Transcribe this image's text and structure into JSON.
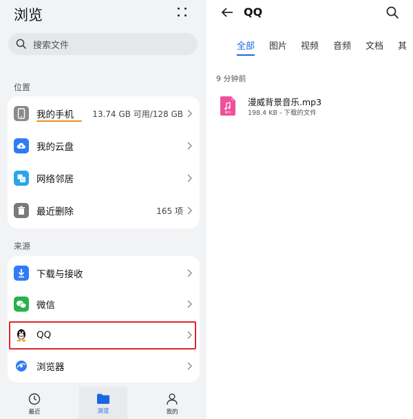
{
  "left": {
    "title": "浏览",
    "search_placeholder": "搜索文件",
    "section_location": "位置",
    "section_source": "来源",
    "location_items": [
      {
        "label": "我的手机",
        "value": "13.74 GB 可用/128 GB",
        "icon": "phone-icon",
        "color": "#8a8a8a",
        "storage_used_fraction": 0.89
      },
      {
        "label": "我的云盘",
        "value": "",
        "icon": "cloud-icon",
        "color": "#2f7cf6"
      },
      {
        "label": "网络邻居",
        "value": "",
        "icon": "network-icon",
        "color": "#2aa6e8"
      },
      {
        "label": "最近删除",
        "value": "165 项",
        "icon": "trash-icon",
        "color": "#7a7a7a"
      }
    ],
    "source_items": [
      {
        "label": "下载与接收",
        "icon": "download-icon",
        "color": "#2f7cf6"
      },
      {
        "label": "微信",
        "icon": "wechat-icon",
        "color": "#2bb14c"
      },
      {
        "label": "QQ",
        "icon": "qq-icon",
        "color": "#111111"
      },
      {
        "label": "浏览器",
        "icon": "browser-icon",
        "color": "#2f7cf6"
      }
    ],
    "nav": [
      {
        "label": "最近",
        "icon": "clock-icon"
      },
      {
        "label": "浏览",
        "icon": "folder-icon",
        "active": true
      },
      {
        "label": "我的",
        "icon": "person-icon"
      }
    ]
  },
  "right": {
    "title": "QQ",
    "tabs": [
      "全部",
      "图片",
      "视频",
      "音频",
      "文档",
      "其"
    ],
    "active_tab": "全部",
    "time_label": "9 分钟前",
    "file": {
      "name": "漫威背景音乐.mp3",
      "meta": "198.4 KB - 下载的文件",
      "icon_label": "MP3",
      "icon_color": "#f0509b"
    }
  },
  "colors": {
    "accent": "#1a66e0",
    "highlight": "#e0222a",
    "storage_bar": "#f08a24"
  }
}
